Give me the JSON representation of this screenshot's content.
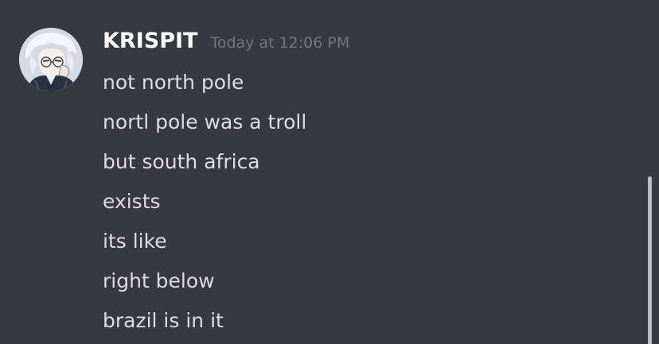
{
  "message": {
    "username": "KRISPIT",
    "timestamp": "Today at 12:06 PM",
    "lines": [
      "not north pole",
      "nortl pole was a troll",
      "but south africa",
      "exists",
      "its like",
      "right below",
      "brazil is in it"
    ]
  },
  "avatar": {
    "icon": "anime-character-avatar"
  },
  "colors": {
    "background": "#36393f",
    "username": "#ffffff",
    "timestamp": "#72767d",
    "message_text": "#dcddde",
    "scrollbar_thumb": "#b9bbbe"
  }
}
